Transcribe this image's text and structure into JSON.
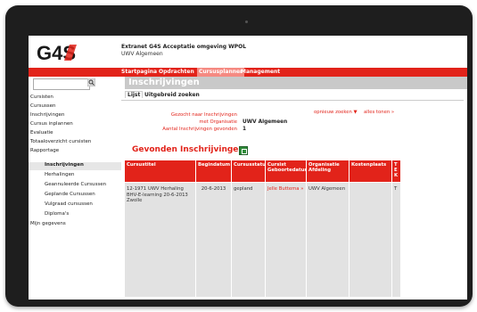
{
  "header": {
    "app_title": "Extranet G4S Acceptatie omgeving WPOL",
    "app_subtitle": "UWV Algemeen",
    "logo_text": "G4S"
  },
  "nav": {
    "items": [
      {
        "label": "Startpagina"
      },
      {
        "label": "Opdrachten"
      },
      {
        "label": "Cursusplanner"
      },
      {
        "label": "Management"
      }
    ],
    "active": "Cursusplanner"
  },
  "sidebar": {
    "search_placeholder": "",
    "items": [
      {
        "label": "Cursisten"
      },
      {
        "label": "Cursussen"
      },
      {
        "label": "Inschrijvingen"
      },
      {
        "label": "Cursus inplannen"
      },
      {
        "label": "Evaluatie"
      },
      {
        "label": "Totaaloverzicht cursisten"
      },
      {
        "label": "Rapportage"
      },
      {
        "label": "Inschrijvingen"
      },
      {
        "label": "Herhalingen"
      },
      {
        "label": "Geannuleerde Cursussen"
      },
      {
        "label": "Geplande Cursussen"
      },
      {
        "label": "Vulgraad cursussen"
      },
      {
        "label": "Diploma's"
      },
      {
        "label": "Mijn gegevens"
      }
    ]
  },
  "main": {
    "page_title": "Inschrijvingen",
    "tabs": [
      {
        "label": "Lijst"
      },
      {
        "label": "Uitgebreid zoeken"
      }
    ],
    "criteria": {
      "label_1": "Gezocht naar Inschrijvingen",
      "label_2": "met Organisatie",
      "label_3": "Aantal Inschrijvingen gevonden",
      "value_org": "UWV Algemeen",
      "value_count": "1"
    },
    "links": {
      "search_again": "opnieuw zoeken ▼",
      "show_all": "alles tonen »"
    },
    "results_title": "Gevonden Inschrijvingen"
  },
  "table": {
    "columns": [
      "Cursustitel",
      "Begindatum",
      "Cursusstatus",
      "Cursist Geboortedatum",
      "Organisatie Afdeling",
      "Kostenplaats",
      "T E K"
    ],
    "rows": [
      {
        "cursustitel": "12-1971 UWV Herhaling BHV-E-learning 20-6-2013 Zwolle",
        "begindatum": "20-6-2013",
        "cursusstatus": "gepland",
        "cursist": "Jelle Buttema »",
        "organisatie": "UWV Algemeen",
        "kostenplaats": "",
        "extra": "T"
      }
    ]
  },
  "colors": {
    "brand_red": "#e2231a",
    "header_gray": "#c9c9c9",
    "row_gray": "#e2e2e2"
  }
}
